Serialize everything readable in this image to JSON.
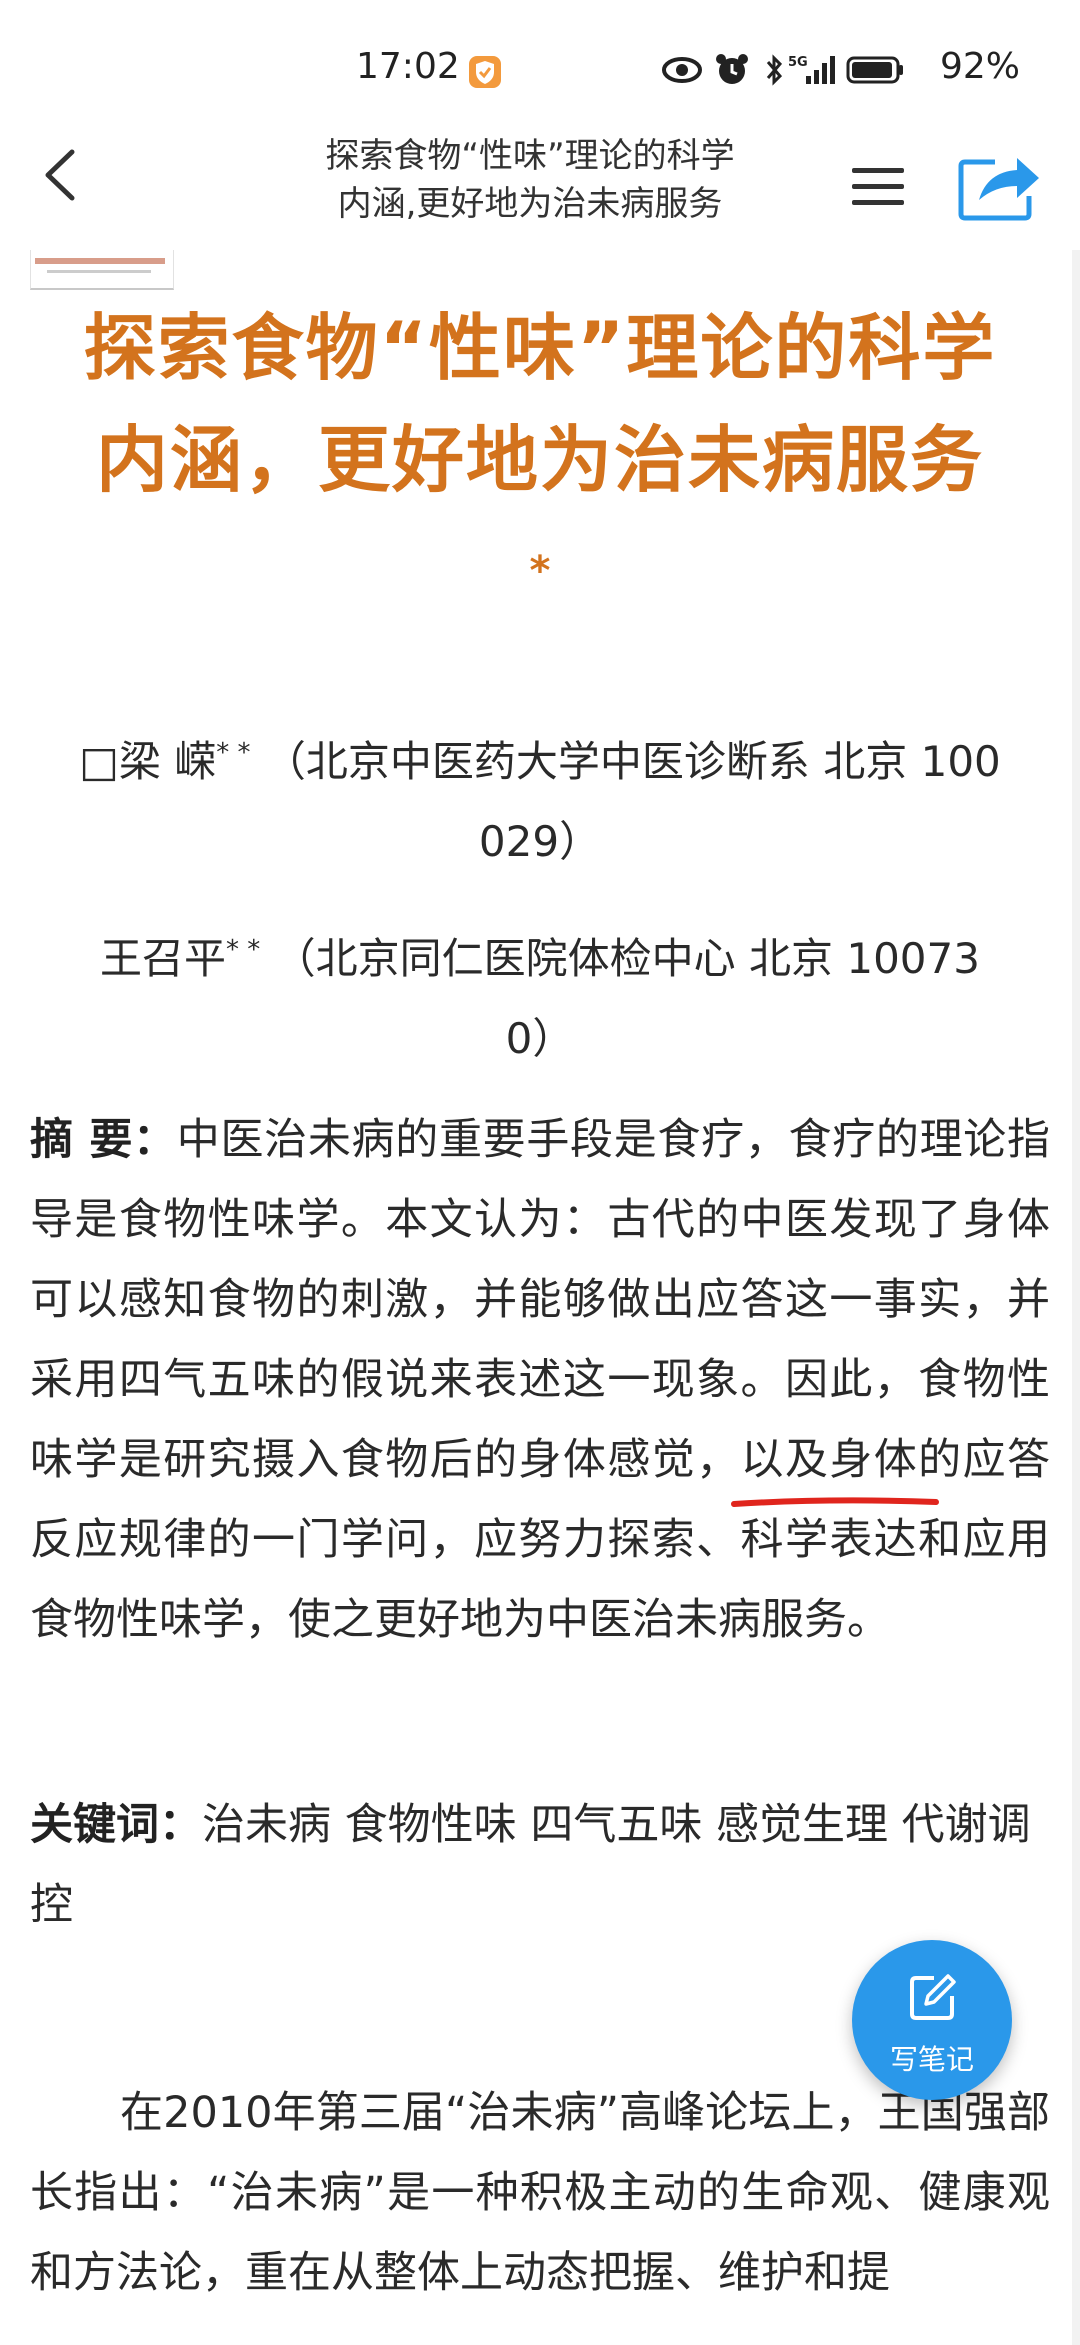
{
  "status_bar": {
    "time": "17:02",
    "network": "5G",
    "battery": "92%"
  },
  "header": {
    "title_line1": "探索食物“性味”理论的科学",
    "title_line2": "内涵,更好地为治未病服务"
  },
  "article": {
    "title_line1": "探索食物“性味”理论的科学",
    "title_line2": "内涵，更好地为治未病服务",
    "title_star": "*",
    "author1": {
      "name": "□梁 嵘",
      "mark": "* *",
      "affiliation_line1": "（北京中医药大学中医诊断系 北京 100",
      "affiliation_line2": "029）"
    },
    "author2": {
      "name": "王召平",
      "mark": "* *",
      "affiliation_line1": "（北京同仁医院体检中心 北京 10073",
      "affiliation_line2": "0）"
    },
    "abstract_label": "摘 要：",
    "abstract_text": "中医治未病的重要手段是食疗，食疗的理论指导是食物性味学。本文认为：古代的中医发现了身体可以感知食物的刺激，并能够做出应答这一事实，并采用四气五味的假说来表述这一现象。因此，食物性味学是研究摄入食物后的身体感觉，以及身体的应答反应规律的一门学问，应努力探索、科学表达和应用食物性味学，使之更好地为中医治未病服务。",
    "keywords_label": "关键词：",
    "keywords_text": "治未病 食物性味 四气五味 感觉生理 代谢调控",
    "body_text": "在2010年第三届“治未病”高峰论坛上，王国强部长指出：“治未病”是一种积极主动的生命观、健康观和方法论，重在从整体上动态把握、维护和提"
  },
  "fab": {
    "label": "写笔记"
  },
  "colors": {
    "title_orange": "#d3731d",
    "fab_blue": "#2a98ea",
    "underline_red": "#e0251d",
    "share_blue": "#2a98ea"
  },
  "icons": {
    "back": "chevron-left-icon",
    "menu": "hamburger-icon",
    "share": "share-icon",
    "fab": "edit-note-icon"
  }
}
